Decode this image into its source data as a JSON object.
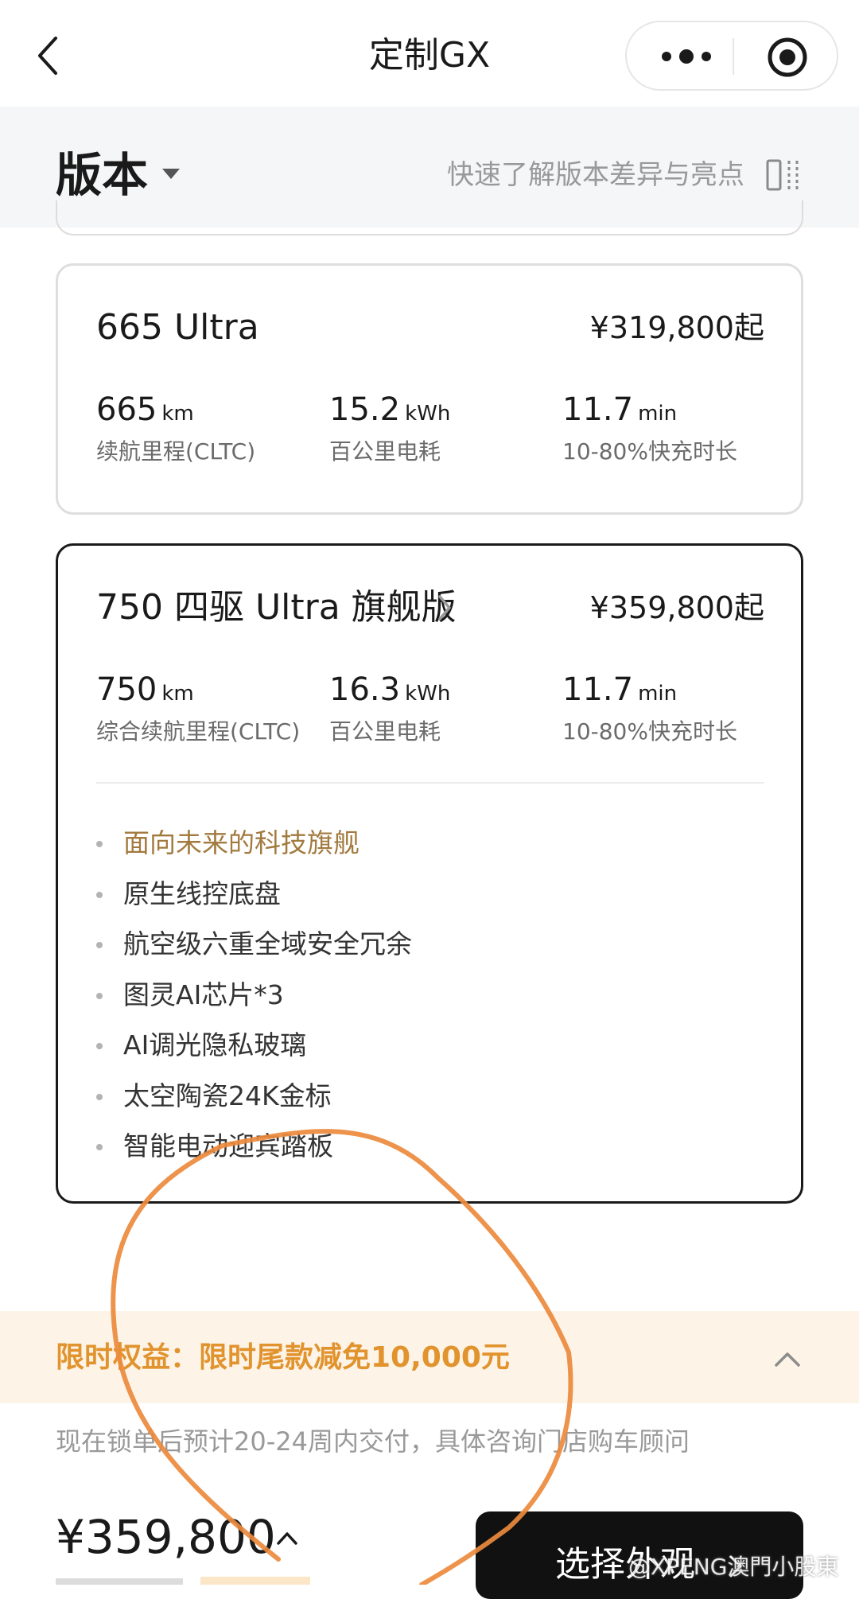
{
  "nav": {
    "title": "定制GX"
  },
  "version": {
    "title": "版本",
    "compare_link": "快速了解版本差异与亮点"
  },
  "cards": [
    {
      "name": "665 Ultra",
      "price": "¥319,800起",
      "specs": [
        {
          "value": "665",
          "unit": "km",
          "label": "续航里程(CLTC)"
        },
        {
          "value": "15.2",
          "unit": "kWh",
          "label": "百公里电耗"
        },
        {
          "value": "11.7",
          "unit": "min",
          "label": "10-80%快充时长"
        }
      ]
    },
    {
      "name": "750 四驱 Ultra 旗舰版",
      "price": "¥359,800起",
      "specs": [
        {
          "value": "750",
          "unit": "km",
          "label": "综合续航里程(CLTC)"
        },
        {
          "value": "16.3",
          "unit": "kWh",
          "label": "百公里电耗"
        },
        {
          "value": "11.7",
          "unit": "min",
          "label": "10-80%快充时长"
        }
      ],
      "features": [
        "面向未来的科技旗舰",
        "原生线控底盘",
        "航空级六重全域安全冗余",
        "图灵AI芯片*3",
        "AI调光隐私玻璃",
        "太空陶瓷24K金标",
        "智能电动迎宾踏板"
      ]
    }
  ],
  "promo": {
    "text": "限时权益：限时尾款减免10,000元"
  },
  "delivery_note": "现在锁单后预计20-24周内交付，具体咨询门店购车顾问",
  "footer": {
    "total_price": "¥359,800",
    "cta_label": "选择外观"
  },
  "watermark": "@XPENG澳門小股東",
  "colors": {
    "promo_text": "#e1932d",
    "promo_bg": "#fdf3e7",
    "feature_highlight": "#a27a3e",
    "annotation_stroke": "#ec8a3d"
  },
  "icons": {
    "back": "back-arrow-icon",
    "more": "more-dots-icon",
    "close_target": "target-circle-icon",
    "compare": "compare-icon",
    "dropdown": "triangle-down-icon",
    "chevron": "chevron-right-icon",
    "collapse": "chevron-up-icon"
  }
}
